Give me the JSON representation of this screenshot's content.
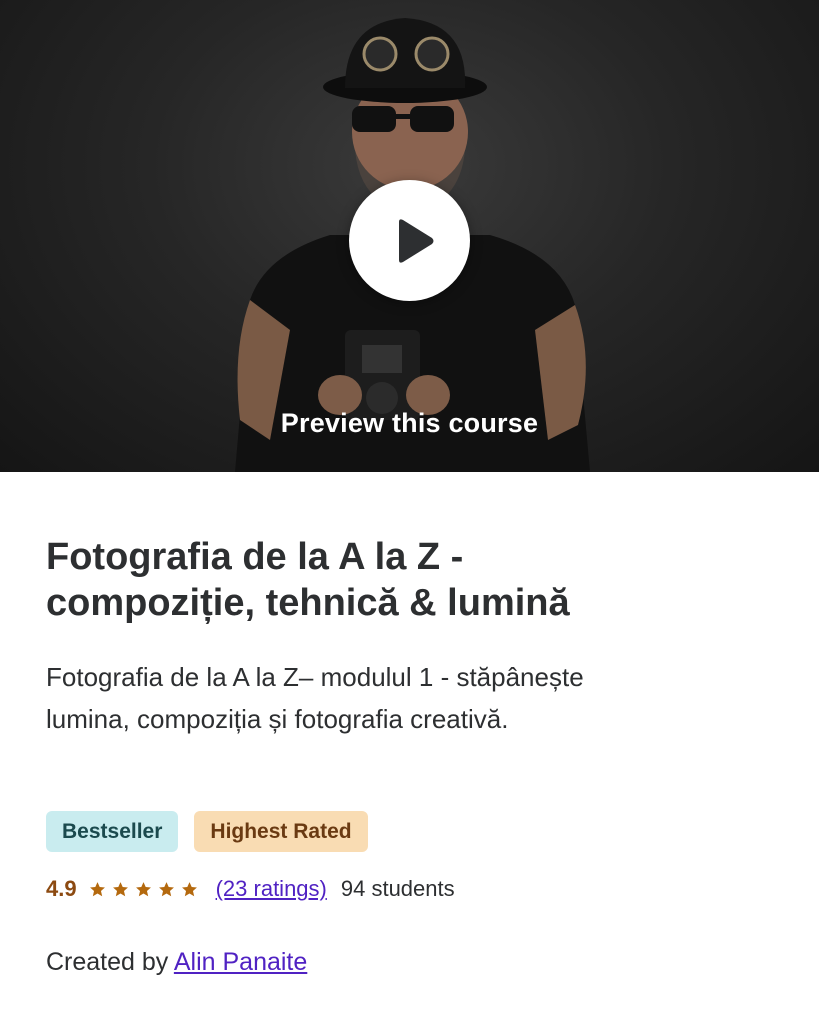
{
  "preview": {
    "label": "Preview this course",
    "play_icon": "play-icon"
  },
  "course": {
    "title_line1": "Fotografia de la A la Z -",
    "title_line2": "compoziție, tehnică & lumină",
    "subtitle_line1": "Fotografia de la A la Z– modulul 1 - stăpânește",
    "subtitle_line2": "lumina, compoziția și fotografia creativă."
  },
  "badges": {
    "bestseller": "Bestseller",
    "highest_rated": "Highest Rated"
  },
  "rating": {
    "value": "4.9",
    "stars_filled": 5,
    "stars_total": 5,
    "ratings_link": "(23 ratings)",
    "students": "94 students"
  },
  "instructor": {
    "prefix": "Created by ",
    "name": "Alin Panaite"
  },
  "colors": {
    "star": "#b4690e",
    "link": "#5022c3",
    "bestseller_bg": "#c9ecef",
    "highest_rated_bg": "#f9dcb3"
  }
}
